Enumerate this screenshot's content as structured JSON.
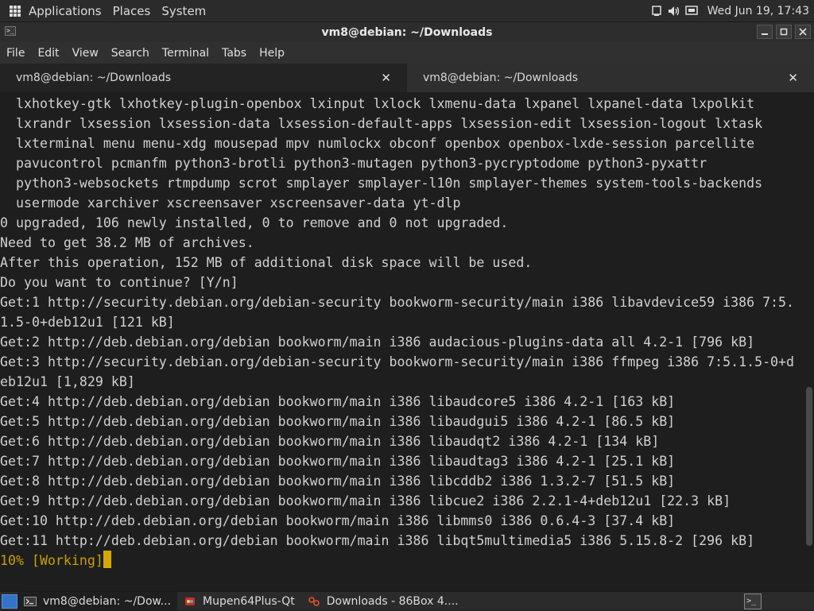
{
  "top_panel": {
    "menus": [
      "Applications",
      "Places",
      "System"
    ],
    "clock": "Wed Jun 19, 17:43"
  },
  "window": {
    "title": "vm8@debian: ~/Downloads",
    "icon": "terminal-icon",
    "controls": [
      "minimize",
      "maximize",
      "close"
    ]
  },
  "menubar": [
    "File",
    "Edit",
    "View",
    "Search",
    "Terminal",
    "Tabs",
    "Help"
  ],
  "tabs": [
    {
      "label": "vm8@debian: ~/Downloads",
      "active": false
    },
    {
      "label": "vm8@debian: ~/Downloads",
      "active": true
    }
  ],
  "terminal": {
    "lines": [
      "  lxhotkey-gtk lxhotkey-plugin-openbox lxinput lxlock lxmenu-data lxpanel lxpanel-data lxpolkit",
      "  lxrandr lxsession lxsession-data lxsession-default-apps lxsession-edit lxsession-logout lxtask",
      "  lxterminal menu menu-xdg mousepad mpv numlockx obconf openbox openbox-lxde-session parcellite",
      "  pavucontrol pcmanfm python3-brotli python3-mutagen python3-pycryptodome python3-pyxattr",
      "  python3-websockets rtmpdump scrot smplayer smplayer-l10n smplayer-themes system-tools-backends",
      "  usermode xarchiver xscreensaver xscreensaver-data yt-dlp",
      "0 upgraded, 106 newly installed, 0 to remove and 0 not upgraded.",
      "Need to get 38.2 MB of archives.",
      "After this operation, 152 MB of additional disk space will be used.",
      "Do you want to continue? [Y/n]",
      "Get:1 http://security.debian.org/debian-security bookworm-security/main i386 libavdevice59 i386 7:5.",
      "1.5-0+deb12u1 [121 kB]",
      "Get:2 http://deb.debian.org/debian bookworm/main i386 audacious-plugins-data all 4.2-1 [796 kB]",
      "Get:3 http://security.debian.org/debian-security bookworm-security/main i386 ffmpeg i386 7:5.1.5-0+d",
      "eb12u1 [1,829 kB]",
      "Get:4 http://deb.debian.org/debian bookworm/main i386 libaudcore5 i386 4.2-1 [163 kB]",
      "Get:5 http://deb.debian.org/debian bookworm/main i386 libaudgui5 i386 4.2-1 [86.5 kB]",
      "Get:6 http://deb.debian.org/debian bookworm/main i386 libaudqt2 i386 4.2-1 [134 kB]",
      "Get:7 http://deb.debian.org/debian bookworm/main i386 libaudtag3 i386 4.2-1 [25.1 kB]",
      "Get:8 http://deb.debian.org/debian bookworm/main i386 libcddb2 i386 1.3.2-7 [51.5 kB]",
      "Get:9 http://deb.debian.org/debian bookworm/main i386 libcue2 i386 2.2.1-4+deb12u1 [22.3 kB]",
      "Get:10 http://deb.debian.org/debian bookworm/main i386 libmms0 i386 0.6.4-3 [37.4 kB]",
      "Get:11 http://deb.debian.org/debian bookworm/main i386 libqt5multimedia5 i386 5.15.8-2 [296 kB]"
    ],
    "status_line": "10% [Working]",
    "prompt_color": "#c8a000",
    "scroll_position": 0.88
  },
  "taskbar": {
    "tasks": [
      {
        "label": "vm8@debian: ~/Dow...",
        "icon": "terminal-icon",
        "active": true
      },
      {
        "label": "Mupen64Plus-Qt",
        "icon": "mupen-icon",
        "active": false
      },
      {
        "label": "Downloads - 86Box 4....",
        "icon": "86box-icon",
        "active": false
      }
    ]
  }
}
